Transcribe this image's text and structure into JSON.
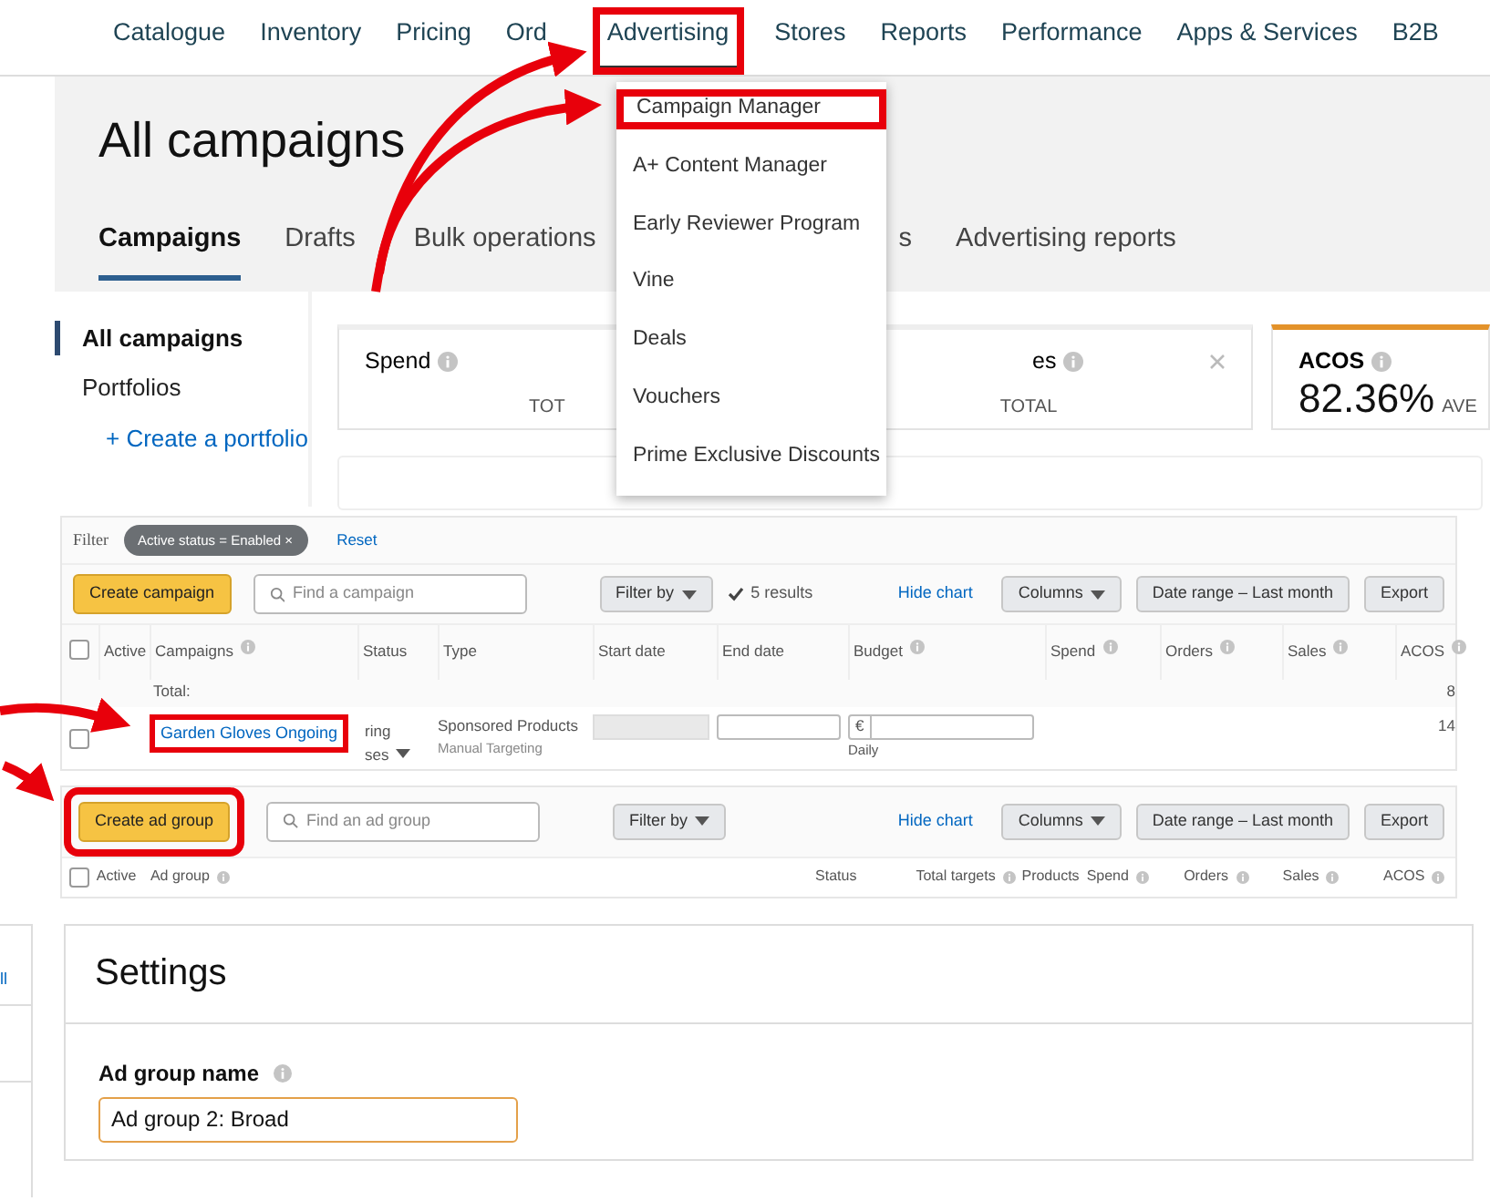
{
  "nav": [
    {
      "label": "Catalogue",
      "selected": false,
      "highlighted": false
    },
    {
      "label": "Inventory",
      "selected": false,
      "highlighted": false
    },
    {
      "label": "Pricing",
      "selected": false,
      "highlighted": false
    },
    {
      "label": "Ord",
      "selected": false,
      "highlighted": false
    },
    {
      "label": "Advertising",
      "selected": true,
      "highlighted": true
    },
    {
      "label": "Stores",
      "selected": false,
      "highlighted": false
    },
    {
      "label": "Reports",
      "selected": false,
      "highlighted": false
    },
    {
      "label": "Performance",
      "selected": false,
      "highlighted": false
    },
    {
      "label": "Apps & Services",
      "selected": false,
      "highlighted": false
    },
    {
      "label": "B2B",
      "selected": false,
      "highlighted": false
    }
  ],
  "menu": [
    {
      "label": "Campaign Manager",
      "highlighted": true
    },
    {
      "label": "A+ Content Manager",
      "highlighted": false
    },
    {
      "label": "Early Reviewer Program",
      "highlighted": false
    },
    {
      "label": "Vine",
      "highlighted": false
    },
    {
      "label": "Deals",
      "highlighted": false
    },
    {
      "label": "Vouchers",
      "highlighted": false
    },
    {
      "label": "Prime Exclusive Discounts",
      "highlighted": false
    }
  ],
  "title": "All campaigns",
  "tabs": [
    {
      "label": "Campaigns",
      "selected": true
    },
    {
      "label": "Drafts",
      "selected": false
    },
    {
      "label": "Bulk operations",
      "selected": false
    },
    {
      "label": "s",
      "selected": false
    },
    {
      "label": "Advertising reports",
      "selected": false
    }
  ],
  "sidebar": {
    "items": [
      {
        "label": "All campaigns",
        "selected": true
      },
      {
        "label": "Portfolios",
        "selected": false
      }
    ],
    "link": "+ Create a portfolio"
  },
  "cards": [
    {
      "title": "Spend",
      "total": "TOT",
      "selected": false
    },
    {
      "title": "es",
      "total": "TOTAL",
      "selected": false,
      "closable": true
    },
    {
      "title": "ACOS",
      "value": "82.36%",
      "total": "AVE",
      "selected": true
    }
  ],
  "campaigns": {
    "filter_label": "Filter",
    "filter_chip": "Active status = Enabled ×",
    "reset": "Reset",
    "create": "Create campaign",
    "search_placeholder": "Find a campaign",
    "filter_by": "Filter by",
    "results": "5 results",
    "hide_chart": "Hide chart",
    "columns_button": "Columns",
    "date_range": "Date range – Last month",
    "export": "Export",
    "columns": [
      "Active",
      "Campaigns",
      "Status",
      "Type",
      "Start date",
      "End date",
      "Budget",
      "Spend",
      "Orders",
      "Sales",
      "ACOS"
    ],
    "header_checked": false,
    "total": {
      "label": "Total:",
      "acos": "8"
    },
    "rows": [
      {
        "checked": false,
        "name": "Garden Gloves Ongoing",
        "highlighted": true,
        "status": [
          "ring",
          "ses"
        ],
        "type": "Sponsored Products",
        "targeting": "Manual Targeting",
        "currency": "€",
        "budget_period": "Daily",
        "acos": "14"
      }
    ]
  },
  "ad_groups": {
    "create": "Create ad group",
    "highlighted": true,
    "search_placeholder": "Find an ad group",
    "filter_by": "Filter by",
    "hide_chart": "Hide chart",
    "columns_button": "Columns",
    "date_range": "Date range – Last month",
    "export": "Export",
    "columns": [
      "Active",
      "Ad group",
      "Status",
      "Total targets",
      "Products",
      "Spend",
      "Orders",
      "Sales",
      "ACOS"
    ],
    "header_checked": false
  },
  "side_fragment": {
    "link": "ll"
  },
  "settings": {
    "title": "Settings",
    "field_label": "Ad group name",
    "value": "Ad group 2: Broad"
  }
}
